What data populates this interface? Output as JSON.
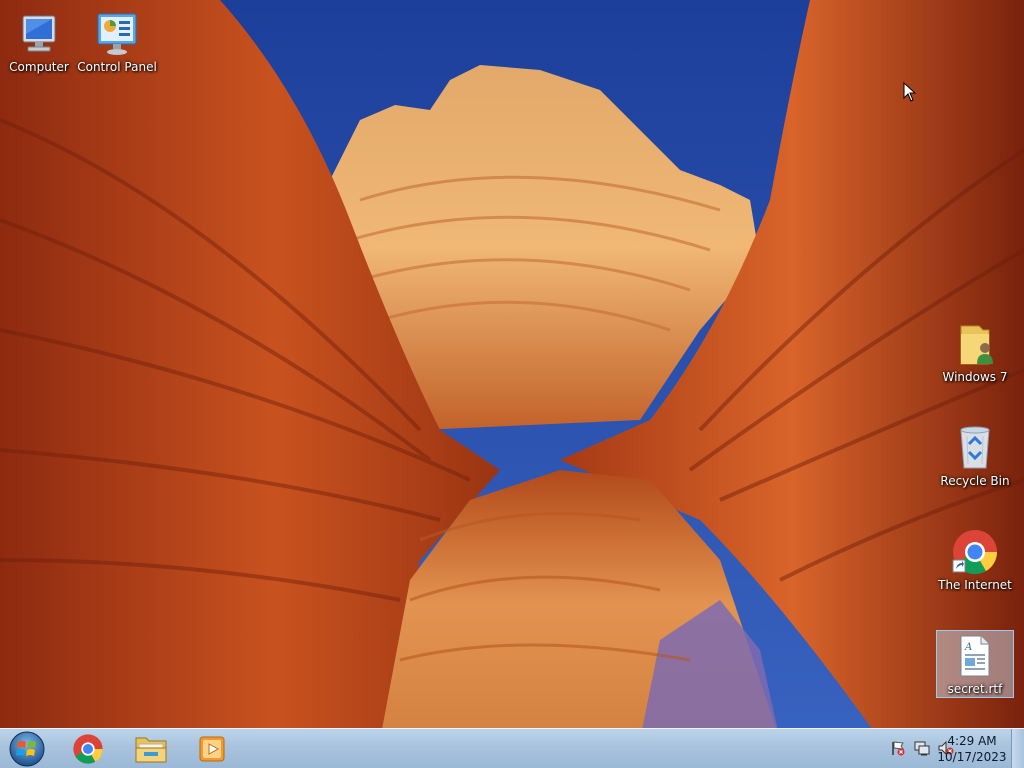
{
  "desktop": {
    "icons_left": [
      {
        "label": "Computer",
        "icon": "computer-icon"
      },
      {
        "label": "Control Panel",
        "icon": "control-panel-icon"
      }
    ],
    "icons_right": [
      {
        "label": "Windows 7",
        "icon": "user-folder-icon"
      },
      {
        "label": "Recycle Bin",
        "icon": "recycle-bin-icon"
      },
      {
        "label": "The Internet",
        "icon": "chrome-shortcut-icon"
      },
      {
        "label": "secret.rtf",
        "icon": "rtf-document-icon",
        "selected": true
      }
    ]
  },
  "taskbar": {
    "start": {
      "icon": "windows-start-orb-icon"
    },
    "pinned": [
      {
        "name": "chrome",
        "icon": "chrome-icon"
      },
      {
        "name": "explorer",
        "icon": "folder-explorer-icon"
      },
      {
        "name": "media-player",
        "icon": "media-player-icon"
      }
    ],
    "tray": [
      {
        "name": "action-center",
        "icon": "action-center-flag-icon"
      },
      {
        "name": "network",
        "icon": "network-icon"
      },
      {
        "name": "volume",
        "icon": "volume-muted-icon"
      }
    ],
    "clock": {
      "time": "4:29 AM",
      "date": "10/17/2023"
    }
  }
}
